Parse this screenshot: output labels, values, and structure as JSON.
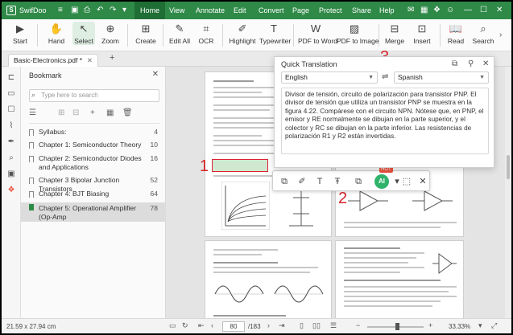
{
  "app": {
    "name": "SwifDoo",
    "menus": [
      "Home",
      "View",
      "Annotate",
      "Edit",
      "Convert",
      "Page",
      "Protect",
      "Share",
      "Help"
    ],
    "active_menu": "Home"
  },
  "toolbar": {
    "start": "Start",
    "hand": "Hand",
    "select": "Select",
    "zoom": "Zoom",
    "create": "Create",
    "edit_all": "Edit All",
    "ocr": "OCR",
    "highlight": "Highlight",
    "typewriter": "Typewriter",
    "pdf_to_word": "PDF to Word",
    "pdf_to_image": "PDF to Image",
    "merge": "Merge",
    "insert": "Insert",
    "read": "Read",
    "search": "Search"
  },
  "tab": {
    "filename": "Basic-Electronics.pdf *"
  },
  "bookmark": {
    "title": "Bookmark",
    "search_placeholder": "Type here to search",
    "items": [
      {
        "label": "Syllabus:",
        "page": "4"
      },
      {
        "label": "Chapter 1: Semiconductor Theory",
        "page": "10"
      },
      {
        "label": "Chapter 2: Semiconductor Diodes and Applications",
        "page": "16"
      },
      {
        "label": "Chapter 3 Bipolar Junction Transistors",
        "page": "52"
      },
      {
        "label": "Chapter 4: BJT Biasing",
        "page": "64"
      },
      {
        "label": "Chapter 5: Operational Amplifier (Op-Amp",
        "page": "78"
      }
    ]
  },
  "quick_translation": {
    "title": "Quick Translation",
    "source_lang": "English",
    "target_lang": "Spanish",
    "translated_text": "Divisor de tensión, circuito de polarización para transistor PNP. El divisor de tensión que utiliza un transistor PNP se muestra en la figura 4.22. Compárese con el circuito NPN. Nótese que, en PNP, el emisor y RE normalmente se dibujan en la parte superior, y el colector y RC se dibujan en la parte inferior. Las resistencias de polarización R1 y R2 están invertidas."
  },
  "float_toolbar": {
    "hot_badge": "HOT",
    "ai_label": "AI"
  },
  "annotations": {
    "mark1": "1",
    "mark2": "2",
    "mark3": "3"
  },
  "status": {
    "page_size": "21.59 x 27.94 cm",
    "current_page": "80",
    "total_pages": "/183",
    "zoom": "33.33%"
  },
  "colors": {
    "brand_green": "#2f8a48",
    "annotation_red": "#d4262a"
  }
}
